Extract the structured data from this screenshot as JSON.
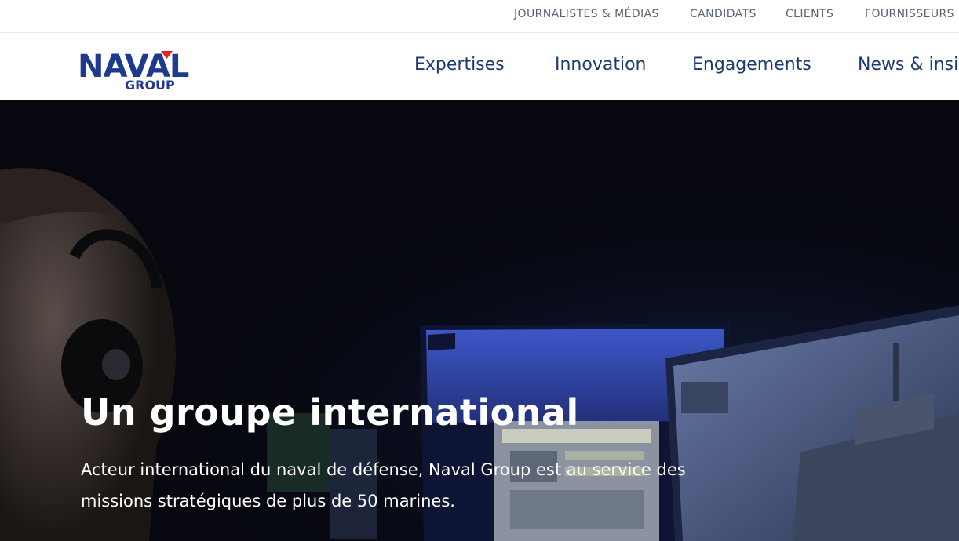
{
  "utility_nav": {
    "items": [
      "JOURNALISTES & MÉDIAS",
      "CANDIDATS",
      "CLIENTS",
      "FOURNISSEURS"
    ]
  },
  "logo": {
    "main": "NAVAL",
    "sub": "GROUP",
    "brand_color": "#1d3a8f",
    "accent_color": "#e0242b"
  },
  "main_nav": {
    "items": [
      "Expertises",
      "Innovation",
      "Engagements",
      "News & insig"
    ]
  },
  "hero": {
    "title": "Un groupe international",
    "text": "Acteur international du naval de défense, Naval Group est au service des missions stratégiques de plus de 50 marines."
  }
}
